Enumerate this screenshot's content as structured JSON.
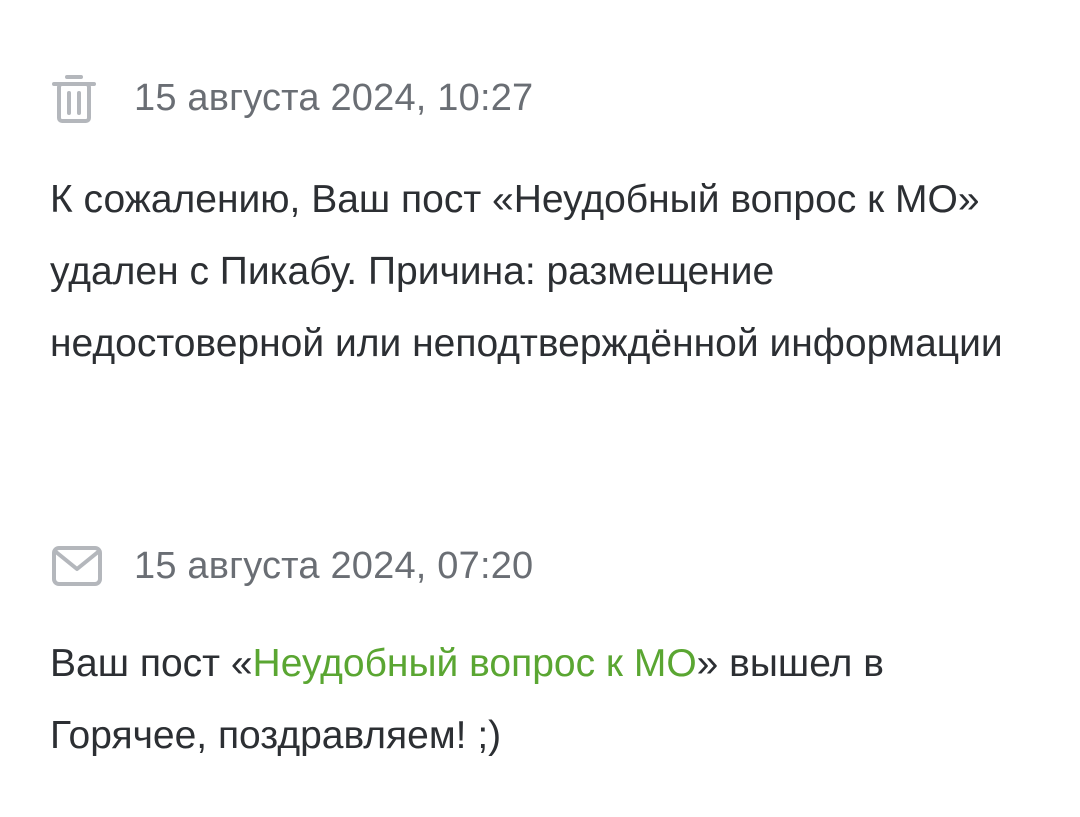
{
  "notifications": [
    {
      "icon": "trash-icon",
      "date": "15 августа 2024, 10:27",
      "text": "К сожалению, Ваш пост «Неудобный вопрос к МО» удален с Пикабу. Причина: размещение недостоверной или неподтверждённой информации"
    },
    {
      "icon": "mail-icon",
      "date": "15 августа 2024, 07:20",
      "text_before": "Ваш пост «",
      "link_text": "Неудобный вопрос к МО",
      "text_after": "» вышел в Горячее, поздравляем! ;)"
    }
  ],
  "colors": {
    "text": "#2c2f33",
    "date": "#6a6e74",
    "icon": "#b4b7bc",
    "link": "#5aa632"
  }
}
